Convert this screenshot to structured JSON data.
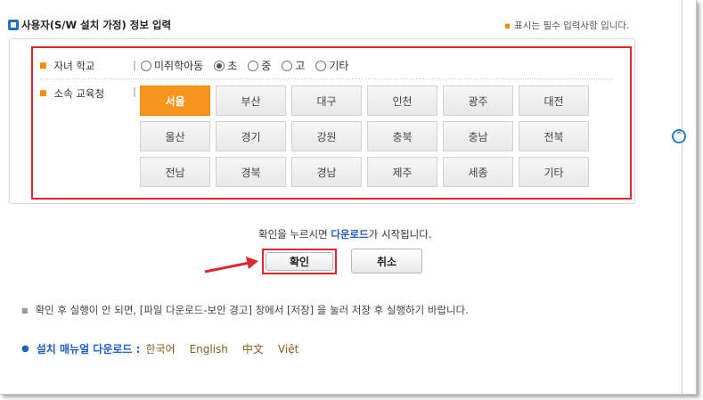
{
  "section": {
    "title": "사용자(S/W 설치 가정) 정보 입력",
    "required_note": "표시는 필수 입력사항 입니다."
  },
  "school": {
    "label": "자녀 학교",
    "options": [
      {
        "label": "미취학아동",
        "checked": false
      },
      {
        "label": "초",
        "checked": true
      },
      {
        "label": "중",
        "checked": false
      },
      {
        "label": "고",
        "checked": false
      },
      {
        "label": "기타",
        "checked": false
      }
    ]
  },
  "office": {
    "label": "소속 교육청",
    "regions": [
      "서울",
      "부산",
      "대구",
      "인천",
      "광주",
      "대전",
      "울산",
      "경기",
      "강원",
      "충북",
      "충남",
      "전북",
      "전남",
      "경북",
      "경남",
      "제주",
      "세종",
      "기타"
    ],
    "selected": "서울"
  },
  "confirm": {
    "message_prefix": "확인을 누르시면 ",
    "message_highlight": "다운로드",
    "message_suffix": "가 시작됩니다.",
    "ok_label": "확인",
    "cancel_label": "취소"
  },
  "notice": "확인 후 실행이 안 되면, [파일 다운로드-보안 경고] 창에서 [저장] 을 눌러 저장 후 실행하기 바랍니다.",
  "manual": {
    "label": "설치 매뉴얼 다운로드 :",
    "languages": [
      "한국어",
      "English",
      "中文",
      "Việt"
    ]
  },
  "colors": {
    "accent": "#f7941d",
    "highlight_red": "#e0262e",
    "link_blue": "#1f5fbf"
  }
}
